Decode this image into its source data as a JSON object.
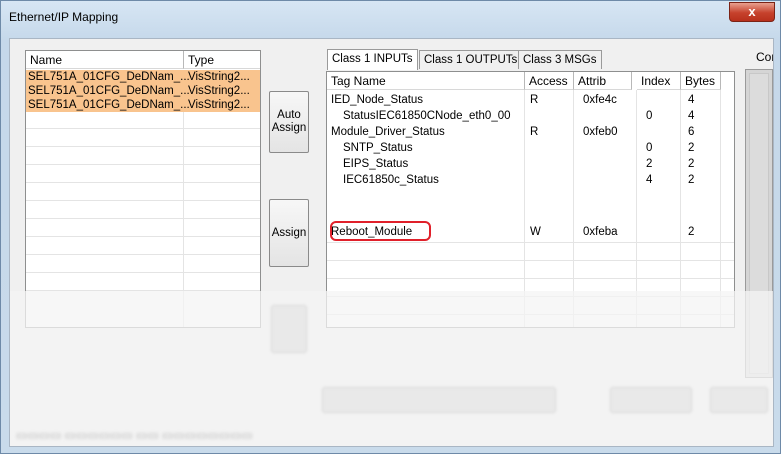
{
  "window": {
    "title": "Ethernet/IP Mapping",
    "close_glyph": "x"
  },
  "left_list": {
    "columns": [
      "Name",
      "Type"
    ],
    "rows": [
      {
        "name": "SEL751A_01CFG_DeDNam_...",
        "type": "VisString2..."
      },
      {
        "name": "SEL751A_01CFG_DeDNam_...",
        "type": "VisString2..."
      },
      {
        "name": "SEL751A_01CFG_DeDNam_...",
        "type": "VisString2..."
      }
    ]
  },
  "buttons": {
    "auto_assign": "Auto\nAssign",
    "assign": "Assign"
  },
  "tabs": [
    "Class 1 INPUTs",
    "Class 1 OUTPUTs",
    "Class 3 MSGs"
  ],
  "tag_list": {
    "columns": [
      "Tag Name",
      "Access",
      "Attrib",
      "Index",
      "Bytes"
    ],
    "rows": [
      {
        "tag": "IED_Node_Status",
        "indent": 0,
        "access": "R",
        "attrib": "0xfe4c",
        "index": "",
        "bytes": "4"
      },
      {
        "tag": "StatusIEC61850CNode_eth0_00",
        "indent": 1,
        "access": "",
        "attrib": "",
        "index": "0",
        "bytes": "4"
      },
      {
        "tag": "Module_Driver_Status",
        "indent": 0,
        "access": "R",
        "attrib": "0xfeb0",
        "index": "",
        "bytes": "6"
      },
      {
        "tag": "SNTP_Status",
        "indent": 1,
        "access": "",
        "attrib": "",
        "index": "0",
        "bytes": "2"
      },
      {
        "tag": "EIPS_Status",
        "indent": 1,
        "access": "",
        "attrib": "",
        "index": "2",
        "bytes": "2"
      },
      {
        "tag": "IEC61850c_Status",
        "indent": 1,
        "access": "",
        "attrib": "",
        "index": "4",
        "bytes": "2"
      },
      {
        "tag": "Reboot_Module",
        "indent": 0,
        "access": "W",
        "attrib": "0xfeba",
        "index": "",
        "bytes": "2"
      }
    ]
  },
  "conn_label": "Conn",
  "colors": {
    "selected_row": "#f9c48e",
    "highlight_ring": "#e0202a",
    "close_button": "#c6412c"
  }
}
